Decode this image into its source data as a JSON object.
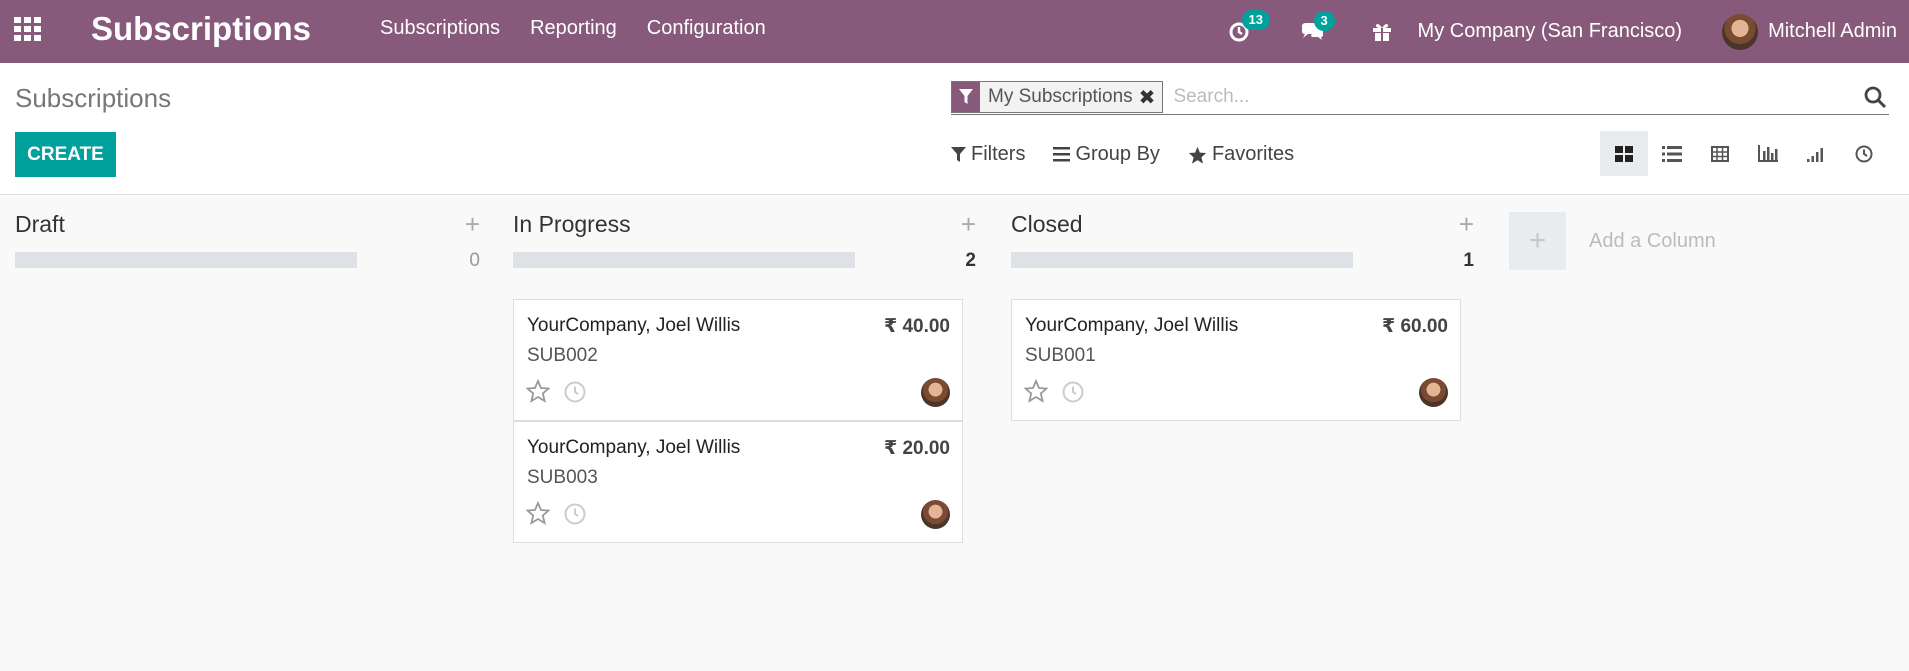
{
  "navbar": {
    "app_title": "Subscriptions",
    "menu": [
      "Subscriptions",
      "Reporting",
      "Configuration"
    ],
    "activity_count": "13",
    "messages_count": "3",
    "company": "My Company (San Francisco)",
    "user": "Mitchell Admin",
    "color": "#875a7b"
  },
  "control_panel": {
    "title": "Subscriptions",
    "create_label": "CREATE",
    "facet_label": "My Subscriptions",
    "search_placeholder": "Search...",
    "filters_label": "Filters",
    "groupby_label": "Group By",
    "favorites_label": "Favorites",
    "views": [
      "kanban-icon",
      "list-icon",
      "pivot-icon",
      "graph-icon",
      "cohort-icon",
      "activity-icon"
    ],
    "active_view": "kanban"
  },
  "kanban": {
    "columns": [
      {
        "title": "Draft",
        "count": "0",
        "cards": []
      },
      {
        "title": "In Progress",
        "count": "2",
        "cards": [
          {
            "customer": "YourCompany, Joel Willis",
            "price": "₹ 40.00",
            "ref": "SUB002"
          },
          {
            "customer": "YourCompany, Joel Willis",
            "price": "₹ 20.00",
            "ref": "SUB003"
          }
        ]
      },
      {
        "title": "Closed",
        "count": "1",
        "cards": [
          {
            "customer": "YourCompany, Joel Willis",
            "price": "₹ 60.00",
            "ref": "SUB001"
          }
        ]
      }
    ],
    "add_column_label": "Add a Column",
    "accent": "#00a09d"
  }
}
